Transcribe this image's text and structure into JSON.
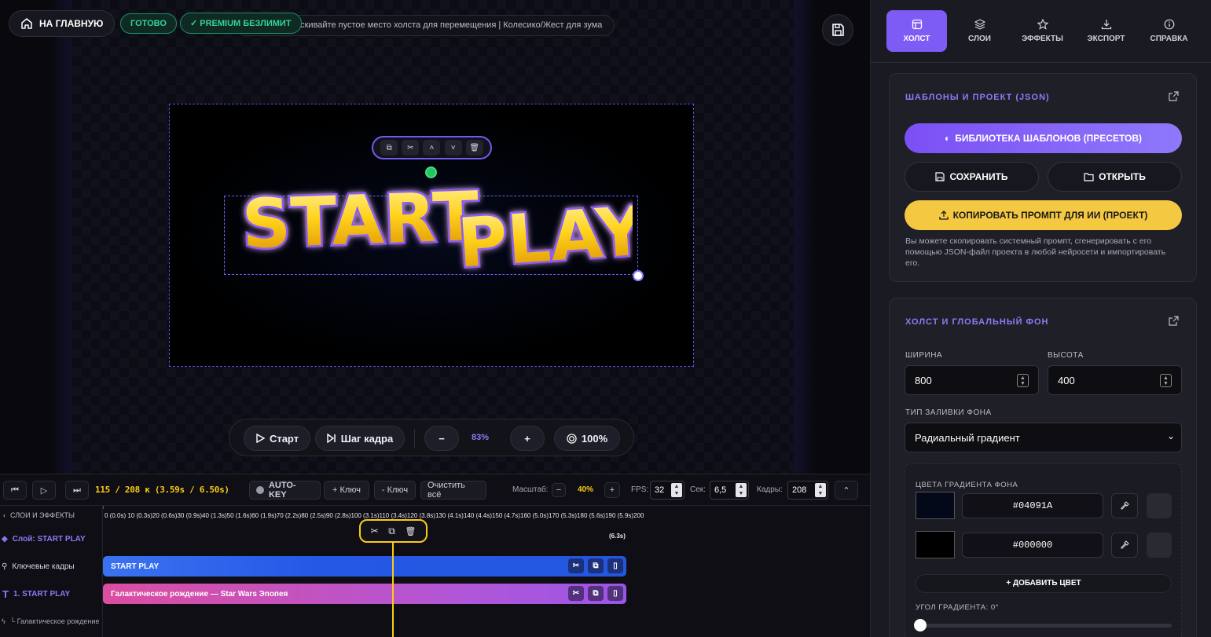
{
  "header": {
    "home_label": "НА ГЛАВНУЮ",
    "ready_badge": "ГОТОВО",
    "premium_badge": "✓ PREMIUM БЕЗЛИМИТ",
    "hint": "аскивайте пустое место холста для перемещения | Колесико/Жест для зума"
  },
  "canvas": {
    "text_line1": "START",
    "text_line2": "PLAY"
  },
  "playback": {
    "start_label": "Старт",
    "step_label": "Шаг кадра",
    "zoom_value": "83%",
    "fit_label": "100%"
  },
  "timeline": {
    "frame_readout": "115 / 208 к (3.59s / 6.50s)",
    "autokey_label": "AUTO-KEY",
    "add_key_label": "+ Ключ",
    "remove_key_label": "- Ключ",
    "clear_all_label": "Очистить всё",
    "scale_label": "Масштаб:",
    "scale_value": "40%",
    "fps_label": "FPS:",
    "fps_value": "32",
    "sec_label": "Сек:",
    "sec_value": "6,5",
    "frames_label": "Кадры:",
    "frames_value": "208",
    "ruler_text": "0 (0.0s)  10 (0.3s)20 (0.6s)30 (0.9s)40 (1.3s)50 (1.6s)60 (1.9s)70 (2.2s)80 (2.5s)90 (2.8s)100 (3.1s)110 (3.4s)120 (3.8s)130 (4.1s)140 (4.4s)150 (4.7s)160 (5.0s)170 (5.3s)180 (5.6s)190 (5.9s)200",
    "ruler_end": "(6.3s)",
    "left_header": "СЛОИ И ЭФФЕКТЫ",
    "row_layer": "Слой: START PLAY",
    "row_keyframes": "Ключевые кадры",
    "row_text": "1. START PLAY",
    "row_effect": "└ Галактическое рождение",
    "track1_label": "START PLAY",
    "track2_label": "Галактическое рождение — Star Wars Эпопея",
    "colors": {
      "track1": "#2563eb",
      "track2_start": "#db4ea1",
      "track2_end": "#9b55e6",
      "playhead": "#facc15"
    }
  },
  "tabs": [
    {
      "label": "ХОЛСТ",
      "icon": "canvas-icon",
      "active": true
    },
    {
      "label": "СЛОИ",
      "icon": "layers-icon"
    },
    {
      "label": "ЭФФЕКТЫ",
      "icon": "star-icon"
    },
    {
      "label": "ЭКСПОРТ",
      "icon": "download-icon"
    },
    {
      "label": "СПРАВКА",
      "icon": "info-icon"
    }
  ],
  "templates_card": {
    "title": "ШАБЛОНЫ И ПРОЕКТ (JSON)",
    "library_label": "БИБЛИОТЕКА ШАБЛОНОВ (ПРЕСЕТОВ)",
    "save_label": "СОХРАНИТЬ",
    "open_label": "ОТКРЫТЬ",
    "copy_prompt_label": "КОПИРОВАТЬ ПРОМПТ ДЛЯ ИИ (ПРОЕКТ)",
    "description": "Вы можете скопировать системный промпт, сгенерировать с его помощью JSON-файл проекта в любой нейросети и импортировать его."
  },
  "canvas_card": {
    "title": "ХОЛСТ И ГЛОБАЛЬНЫЙ ФОН",
    "width_label": "ШИРИНА",
    "width_value": "800",
    "height_label": "ВЫСОТА",
    "height_value": "400",
    "fill_type_label": "ТИП ЗАЛИВКИ ФОНА",
    "fill_type_value": "Радиальный градиент",
    "gradient_colors_label": "ЦВЕТА ГРАДИЕНТА ФОНА",
    "color1": "#04091A",
    "color2": "#000000",
    "add_color_label": "+ ДОБАВИТЬ ЦВЕТ",
    "angle_label": "УГОЛ ГРАДИЕНТА: 0°"
  },
  "theme": {
    "accent": "#7c5cf5",
    "success": "#34d399",
    "yellow": "#f5c842"
  }
}
